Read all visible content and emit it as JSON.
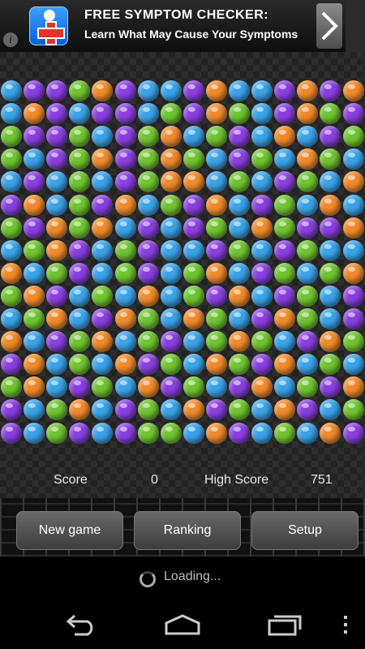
{
  "ad": {
    "title": "FREE SYMPTOM CHECKER:",
    "subtitle": "Learn What May Cause Your Symptoms",
    "info_glyph": "i"
  },
  "board": {
    "rows": [
      "BPPGOPBBPOBBPOPO",
      "BOPBPPBGPOGBPOGP",
      "GPPGBPGOBGPBOBPG",
      "GBPGOPGOGBPGBOGB",
      "BPBGBPGOOBGBPGBO",
      "POBGPOBGPOBPGBOB",
      "GPOGOBPBPGBOGPPO",
      "BGOPBGPBBPGBPGBB",
      "OBGPBGPBGOBPGBGO",
      "GOPBGBOBGPOBPGBP",
      "BGOBPOGBOGBPOGBP",
      "OBPGOBGPBGOGBPOG",
      "POBGBOPGBOGPOBGB",
      "GOBPGBOPGBPOBGPO",
      "PBGOBPGBOPGBOPBG",
      "PBGPBPGGBOPBGBOP"
    ],
    "colors": {
      "B": "#3aa3e8",
      "P": "#8a3fe0",
      "G": "#6fc42f",
      "O": "#f08a2a"
    }
  },
  "score": {
    "label": "Score",
    "value": "0",
    "high_label": "High Score",
    "high_value": "751"
  },
  "buttons": {
    "new_game": "New game",
    "ranking": "Ranking",
    "setup": "Setup"
  },
  "loading": {
    "text": "Loading..."
  },
  "nav": {
    "back_icon": "back-icon",
    "home_icon": "home-icon",
    "recents_icon": "recents-icon",
    "menu_icon": "menu-icon"
  }
}
